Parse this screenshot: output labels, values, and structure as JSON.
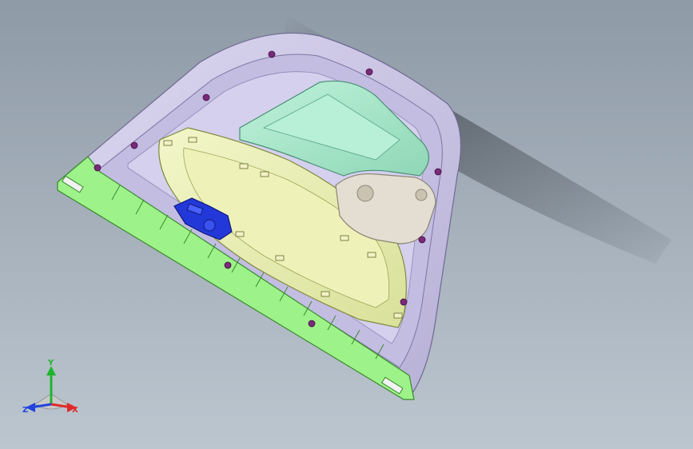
{
  "viewport": {
    "background_top": "#8e9aa6",
    "background_bottom": "#bcc6cf"
  },
  "model": {
    "colors": {
      "housing": "#cbc6e6",
      "housing_edge": "#6f6a92",
      "gasket": "#9ef28a",
      "gasket_edge": "#3a8a2e",
      "inner_panel": "#e7ecae",
      "cover": "#a7e6c9",
      "bracket": "#e3ddd2",
      "latch": "#2338d8",
      "fasteners": "#7a2a7a"
    }
  },
  "triad": {
    "y_label": "Y",
    "x_label": "X",
    "z_label": "Z",
    "y_color": "#1fb52d",
    "x_color": "#e02a2a",
    "z_color": "#2244dd"
  }
}
